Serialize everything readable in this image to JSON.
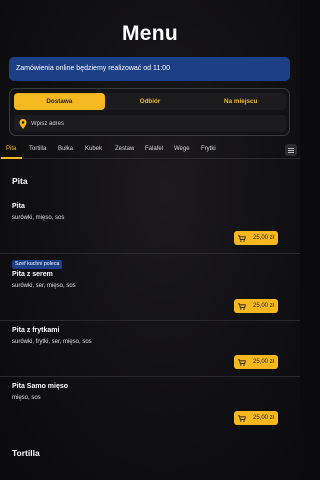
{
  "header": {
    "title": "Menu"
  },
  "notice": {
    "text": "Zamówienia online będziemy realizować od 11:00"
  },
  "order_mode": {
    "options": [
      {
        "label": "Dostawa",
        "active": true
      },
      {
        "label": "Odbiór",
        "active": false
      },
      {
        "label": "Na miejscu",
        "active": false
      }
    ],
    "address_placeholder": "Wpisz adres",
    "accent_color": "#f5b820"
  },
  "categories": {
    "tabs": [
      "Pita",
      "Tortilla",
      "Bułka",
      "Kubek",
      "Zestaw",
      "Falafel",
      "Wege",
      "Frytki"
    ],
    "active": "Pita",
    "menu_icon": "list-icon"
  },
  "sections": [
    {
      "title": "Pita",
      "items": [
        {
          "name": "Pita",
          "description": "surówki, mięso, sos",
          "price": "25,00 zł",
          "badge": ""
        },
        {
          "name": "Pita z serem",
          "description": "surówki, ser, mięso, sos",
          "price": "25,00 zł",
          "badge": "Szef kuchni poleca"
        },
        {
          "name": "Pita z frytkami",
          "description": "surówki, frytki, ser, mięso, sos",
          "price": "25,00 zł",
          "badge": ""
        },
        {
          "name": "Pita Samo mięso",
          "description": "mięso, sos",
          "price": "25,00 zł",
          "badge": ""
        }
      ]
    },
    {
      "title": "Tortilla",
      "items": []
    }
  ]
}
